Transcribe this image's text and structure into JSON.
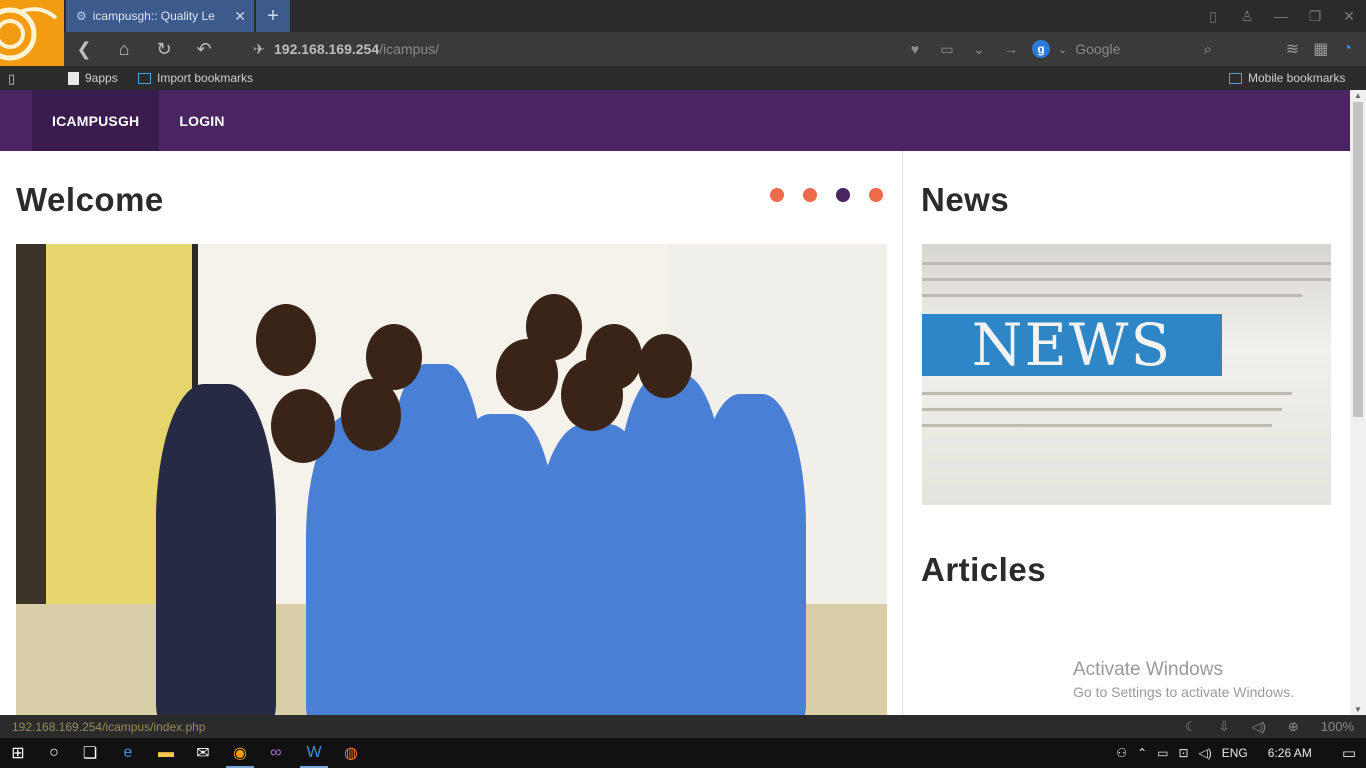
{
  "browser": {
    "tab_title": "icampusgh:: Quality Le",
    "tab_close": "✕",
    "new_tab": "+",
    "url_host": "192.168.169.254",
    "url_path": "/icampus/",
    "search_engine_badge": "g",
    "search_placeholder": "Google",
    "bookmarks": {
      "item1": "9apps",
      "item2": "Import bookmarks",
      "mobile": "Mobile bookmarks"
    },
    "status_url": "192.168.169.254/icampus/index.php",
    "zoom": "100%"
  },
  "site": {
    "nav": {
      "brand": "ICAMPUSGH",
      "login": "LOGIN"
    },
    "welcome_heading": "Welcome",
    "carousel": {
      "count": 4,
      "active_index": 2
    },
    "news_heading": "News",
    "news_banner": "NEWS",
    "articles_heading": "Articles"
  },
  "watermark": {
    "line1": "Activate Windows",
    "line2": "Go to Settings to activate Windows."
  },
  "taskbar": {
    "language": "ENG",
    "time": "6:26 AM"
  },
  "colors": {
    "nav_bg": "#4a2562",
    "nav_active": "#3a1b4e",
    "dot": "#ee6a4a",
    "dot_active": "#4a2562",
    "tab_bg": "#3c5a8c"
  }
}
